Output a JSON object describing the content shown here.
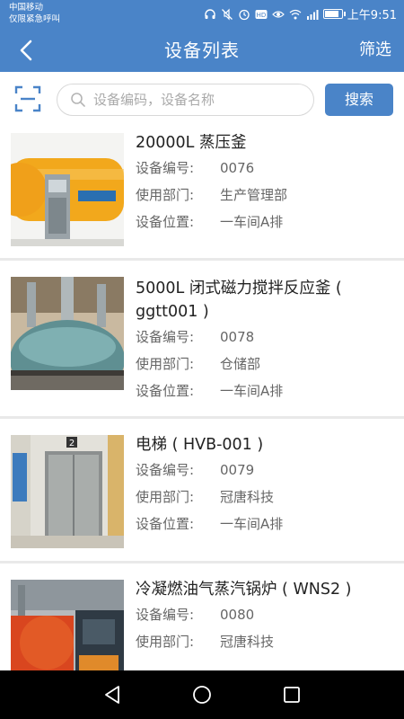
{
  "status_bar": {
    "carrier_line1": "中国移动",
    "carrier_line2": "仅限紧急呼叫",
    "time": "上午9:51",
    "battery_level": 0.9
  },
  "header": {
    "title": "设备列表",
    "filter_label": "筛选"
  },
  "search": {
    "placeholder": "设备编码，设备名称",
    "button_label": "搜索"
  },
  "labels": {
    "code": "设备编号:",
    "dept": "使用部门:",
    "location": "设备位置:"
  },
  "items": [
    {
      "name": "20000L 蒸压釜",
      "code": "0076",
      "dept": "生产管理部",
      "location": "一车间A排"
    },
    {
      "name": "5000L 闭式磁力搅拌反应釜 ( ggtt001 )",
      "code": "0078",
      "dept": "仓储部",
      "location": "一车间A排"
    },
    {
      "name": "电梯 ( HVB-001 )",
      "code": "0079",
      "dept": "冠唐科技",
      "location": "一车间A排"
    },
    {
      "name": "冷凝燃油气蒸汽锅炉 ( WNS2 )",
      "code": "0080",
      "dept": "冠唐科技",
      "location": ""
    }
  ],
  "elevator_floor_sign": "2",
  "colors": {
    "primary": "#4a84c8",
    "divider": "#e9e9e9",
    "text_dark": "#222222",
    "text_muted": "#666666"
  },
  "icons": {
    "back": "chevron-left-icon",
    "scan": "scan-icon",
    "search": "search-icon",
    "nav_back": "triangle-back-icon",
    "nav_home": "circle-home-icon",
    "nav_recents": "square-recents-icon"
  }
}
